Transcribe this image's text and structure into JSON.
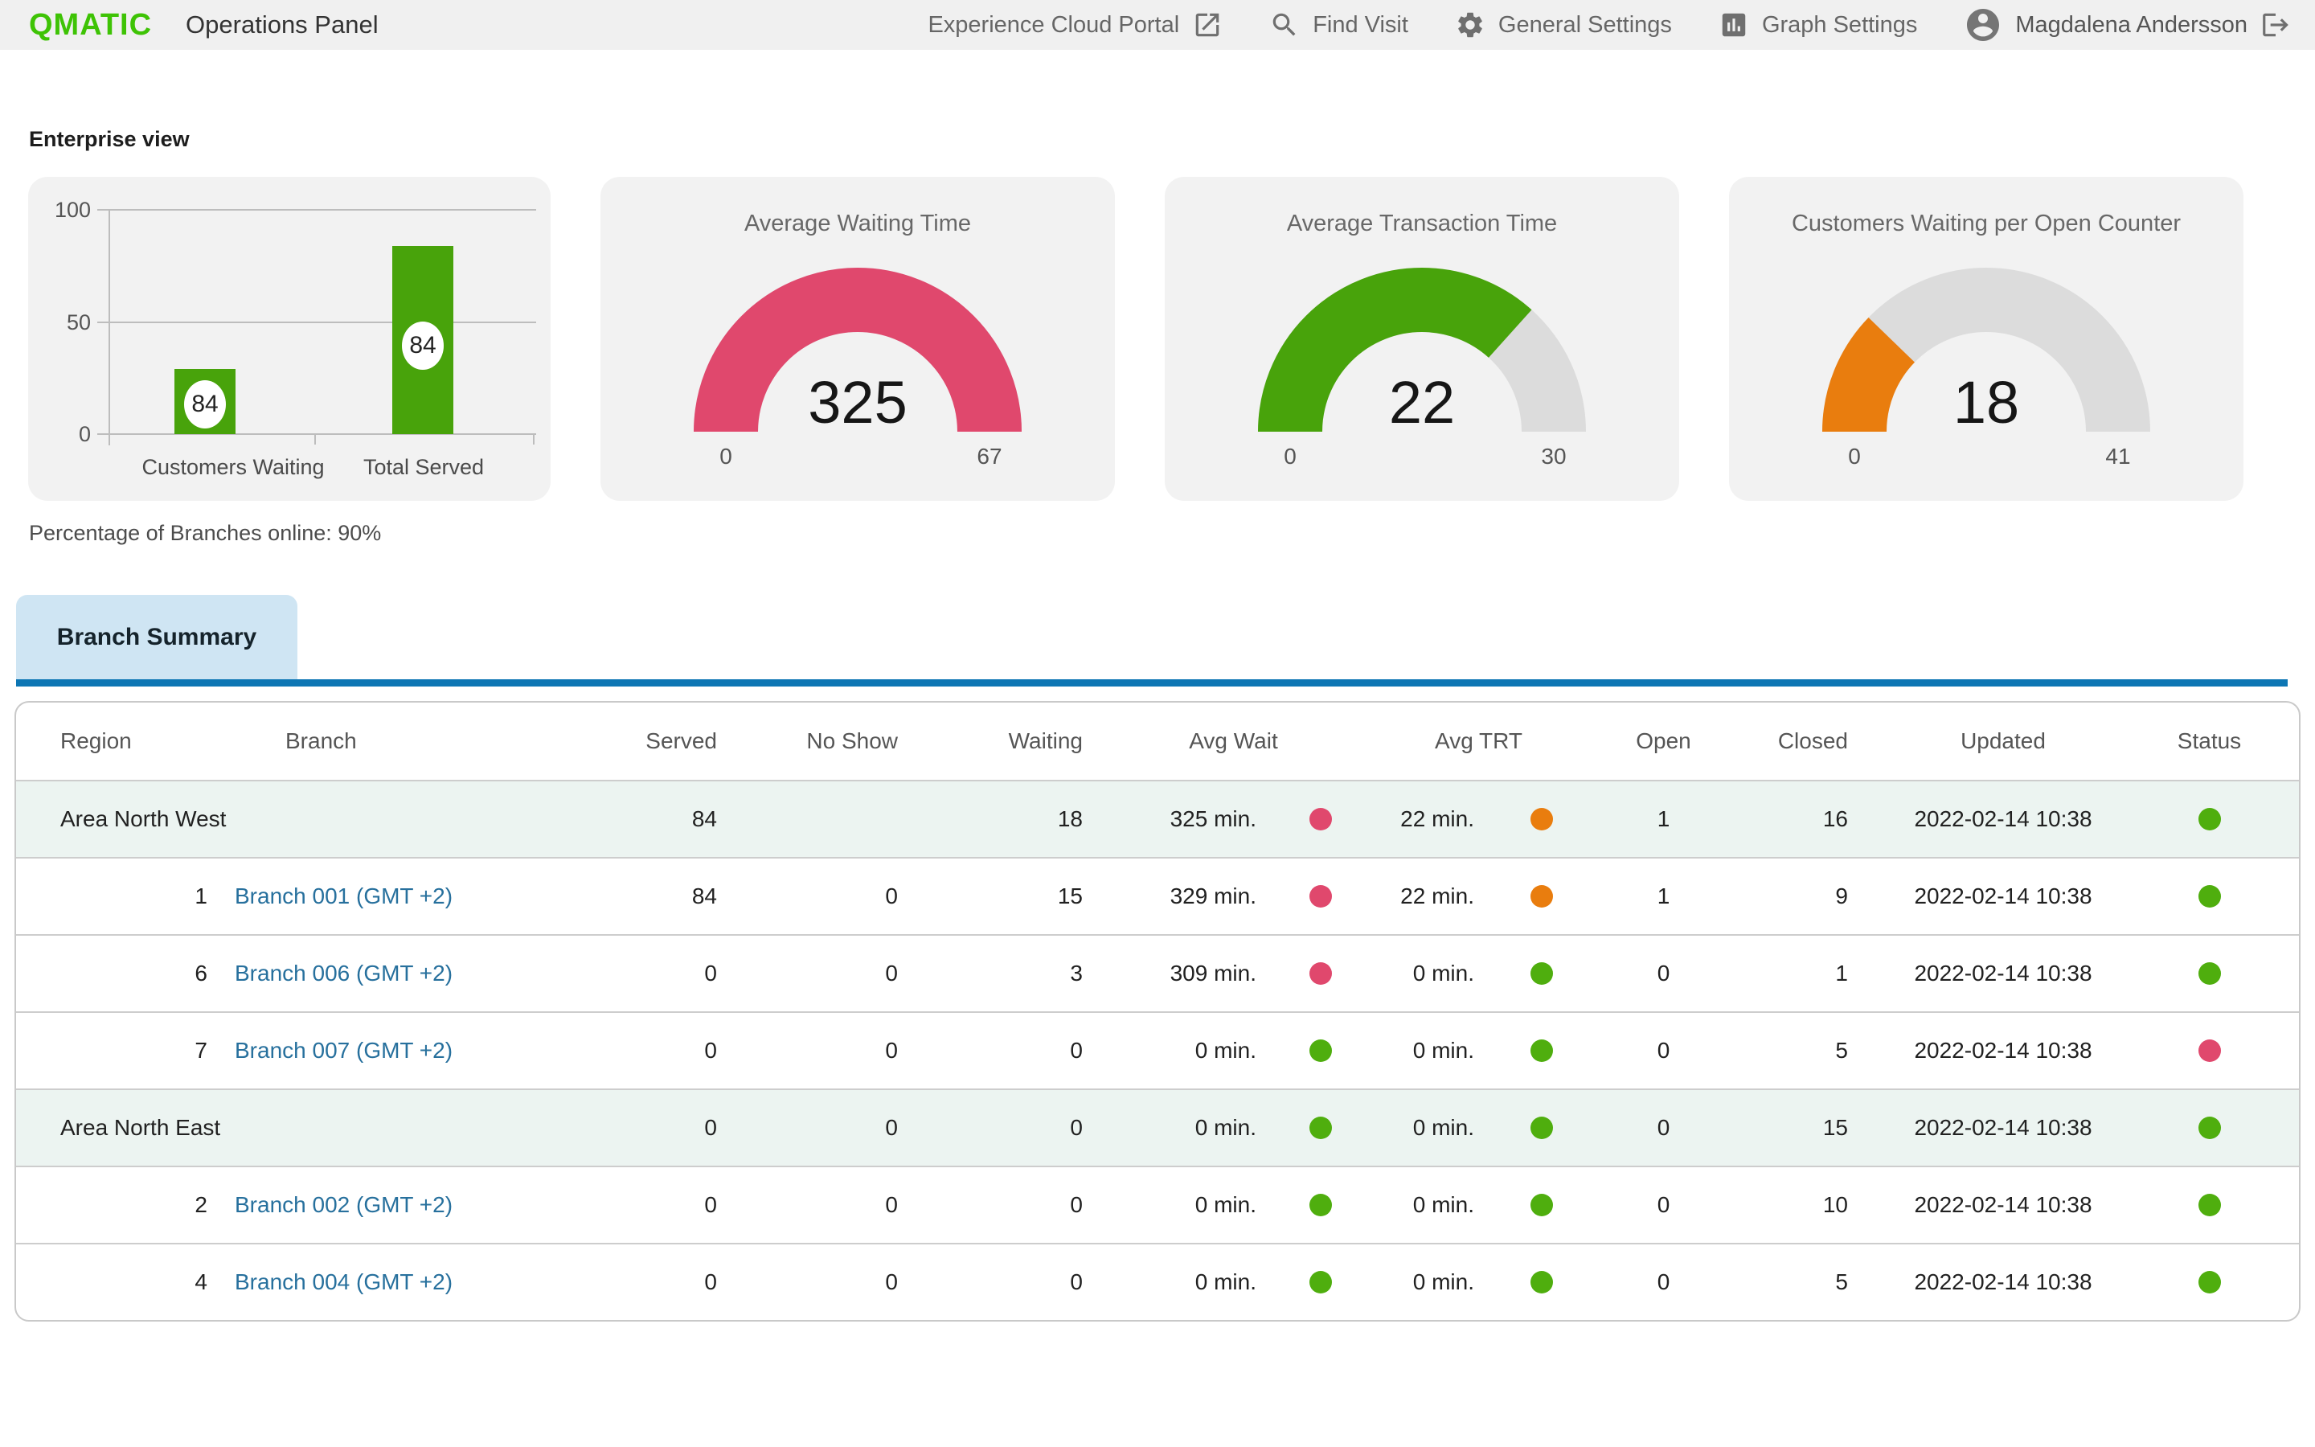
{
  "header": {
    "logo": "QMATIC",
    "title": "Operations Panel",
    "nav": [
      {
        "label": "Experience Cloud Portal",
        "icon": "external-link-icon",
        "icon_after": true
      },
      {
        "label": "Find Visit",
        "icon": "search-icon",
        "icon_after": false
      },
      {
        "label": "General Settings",
        "icon": "gear-icon",
        "icon_after": false
      },
      {
        "label": "Graph Settings",
        "icon": "bar-chart-icon",
        "icon_after": false
      }
    ],
    "user": {
      "name": "Magdalena Andersson"
    }
  },
  "enterprise": {
    "section_title": "Enterprise view",
    "branches_online": "Percentage of Branches online: 90%"
  },
  "chart_data": [
    {
      "type": "bar",
      "title": "",
      "categories": [
        "Customers Waiting",
        "Total Served"
      ],
      "values": [
        29,
        84
      ],
      "bar_labels": [
        "84",
        "84"
      ],
      "ylim": [
        0,
        100
      ],
      "yticks": [
        0,
        50,
        100
      ],
      "grid": true,
      "bar_color": "#48a30b"
    },
    {
      "type": "gauge",
      "title": "Average Waiting Time",
      "value": "325",
      "min": "0",
      "max": "67",
      "fill_fraction": 1.0,
      "color": "#e0486d"
    },
    {
      "type": "gauge",
      "title": "Average Transaction Time",
      "value": "22",
      "min": "0",
      "max": "30",
      "fill_fraction": 0.733,
      "color": "#48a30b"
    },
    {
      "type": "gauge",
      "title": "Customers Waiting per Open Counter",
      "value": "18",
      "min": "0",
      "max": "41",
      "fill_fraction": 0.245,
      "color": "#e97d0e"
    }
  ],
  "tabs": {
    "branch_summary": "Branch Summary"
  },
  "table": {
    "columns": [
      "Region",
      "Branch",
      "Served",
      "No Show",
      "Waiting",
      "Avg Wait",
      "Avg TRT",
      "Open",
      "Closed",
      "Updated",
      "Status"
    ],
    "rows": [
      {
        "is_group": true,
        "region": "Area North West",
        "branch": "",
        "served": "84",
        "no_show": "",
        "waiting": "18",
        "avg_wait": "325 min.",
        "avg_wait_status": "pink",
        "avg_trt": "22 min.",
        "avg_trt_status": "orange",
        "open": "1",
        "closed": "16",
        "updated": "2022-02-14 10:38",
        "status": "green"
      },
      {
        "is_group": false,
        "region": "1",
        "branch": "Branch 001 (GMT +2)",
        "served": "84",
        "no_show": "0",
        "waiting": "15",
        "avg_wait": "329 min.",
        "avg_wait_status": "pink",
        "avg_trt": "22 min.",
        "avg_trt_status": "orange",
        "open": "1",
        "closed": "9",
        "updated": "2022-02-14 10:38",
        "status": "green"
      },
      {
        "is_group": false,
        "region": "6",
        "branch": "Branch 006 (GMT +2)",
        "served": "0",
        "no_show": "0",
        "waiting": "3",
        "avg_wait": "309 min.",
        "avg_wait_status": "pink",
        "avg_trt": "0 min.",
        "avg_trt_status": "green",
        "open": "0",
        "closed": "1",
        "updated": "2022-02-14 10:38",
        "status": "green"
      },
      {
        "is_group": false,
        "region": "7",
        "branch": "Branch 007 (GMT +2)",
        "served": "0",
        "no_show": "0",
        "waiting": "0",
        "avg_wait": "0 min.",
        "avg_wait_status": "green",
        "avg_trt": "0 min.",
        "avg_trt_status": "green",
        "open": "0",
        "closed": "5",
        "updated": "2022-02-14 10:38",
        "status": "pink"
      },
      {
        "is_group": true,
        "region": "Area North East",
        "branch": "",
        "served": "0",
        "no_show": "0",
        "waiting": "0",
        "avg_wait": "0 min.",
        "avg_wait_status": "green",
        "avg_trt": "0 min.",
        "avg_trt_status": "green",
        "open": "0",
        "closed": "15",
        "updated": "2022-02-14 10:38",
        "status": "green"
      },
      {
        "is_group": false,
        "region": "2",
        "branch": "Branch 002 (GMT +2)",
        "served": "0",
        "no_show": "0",
        "waiting": "0",
        "avg_wait": "0 min.",
        "avg_wait_status": "green",
        "avg_trt": "0 min.",
        "avg_trt_status": "green",
        "open": "0",
        "closed": "10",
        "updated": "2022-02-14 10:38",
        "status": "green"
      },
      {
        "is_group": false,
        "region": "4",
        "branch": "Branch 004 (GMT +2)",
        "served": "0",
        "no_show": "0",
        "waiting": "0",
        "avg_wait": "0 min.",
        "avg_wait_status": "green",
        "avg_trt": "0 min.",
        "avg_trt_status": "green",
        "open": "0",
        "closed": "5",
        "updated": "2022-02-14 10:38",
        "status": "green"
      }
    ]
  },
  "colors": {
    "brand_green": "#3ec305",
    "chart_green": "#48a30b",
    "pink": "#e0486d",
    "orange": "#e97d0e",
    "green": "#4fae0e",
    "tab_blue": "#0d76b4",
    "tab_bg": "#cfe5f3",
    "header_bg": "#f0f0f0",
    "group_row_bg": "#ecf4f1",
    "gauge_track": "#dcdcdc",
    "link_blue": "#27709d"
  }
}
